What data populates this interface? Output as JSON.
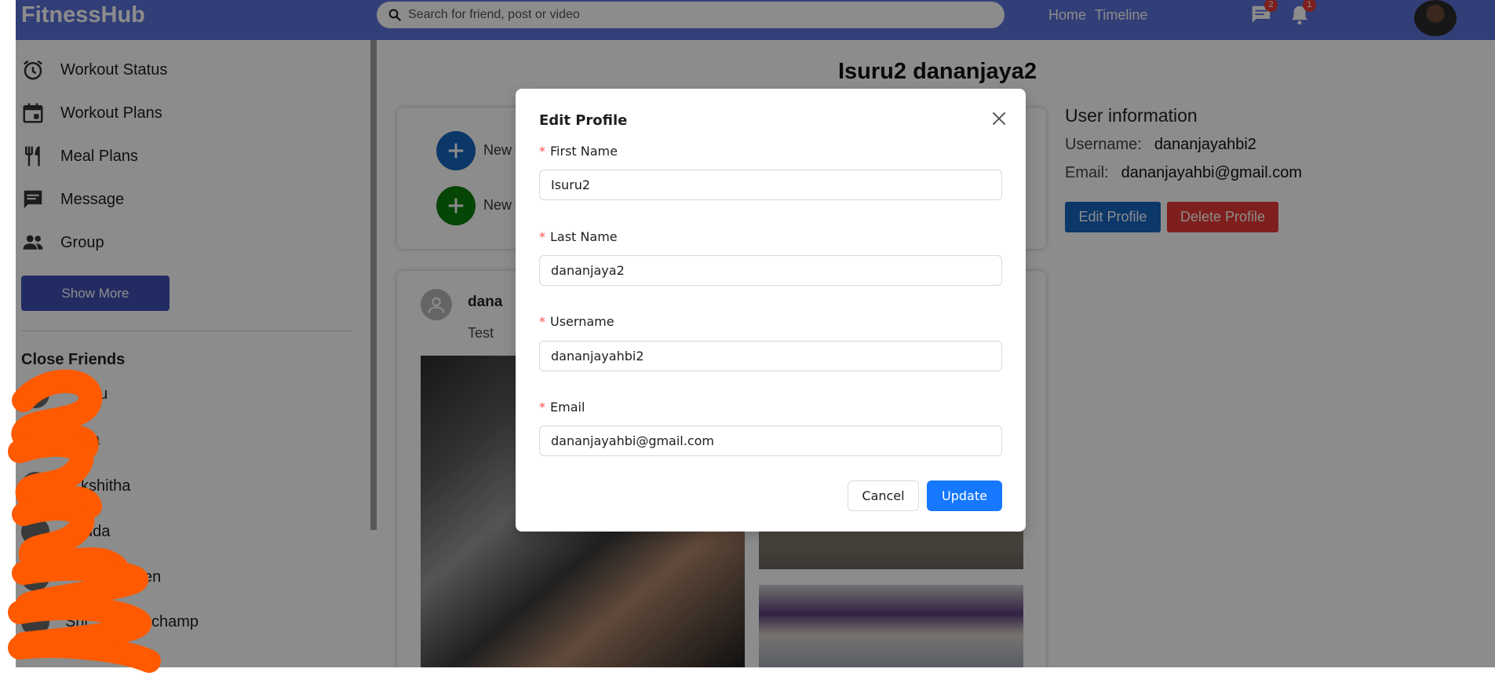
{
  "app": {
    "title": "FitnessHub"
  },
  "header": {
    "search_placeholder": "Search for friend, post or video",
    "nav": [
      "Home",
      "Timeline"
    ],
    "messages_badge": "2",
    "notifications_badge": "1",
    "icons": {
      "search": "search-icon",
      "messages": "chat-icon",
      "notifications": "bell-icon"
    }
  },
  "sidebar": {
    "items": [
      {
        "label": "Workout Status",
        "icon": "alarm-icon"
      },
      {
        "label": "Workout Plans",
        "icon": "calendar-icon"
      },
      {
        "label": "Meal Plans",
        "icon": "utensils-icon"
      },
      {
        "label": "Message",
        "icon": "message-icon"
      },
      {
        "label": "Group",
        "icon": "group-icon"
      }
    ],
    "show_more_label": "Show More",
    "close_friends_title": "Close Friends",
    "friends": [
      "du",
      "nka",
      "kshitha",
      "uda",
      "en",
      "Shi",
      "uchamp"
    ]
  },
  "profile": {
    "name": "Isuru2 dananjaya2",
    "create_items": [
      "New",
      "New"
    ],
    "post": {
      "author": "dana",
      "text": "Test"
    },
    "info": {
      "title": "User information",
      "username_label": "Username:",
      "username_value": "dananjayahbi2",
      "email_label": "Email:",
      "email_value": "dananjayahbi@gmail.com",
      "edit_label": "Edit Profile",
      "delete_label": "Delete Profile"
    }
  },
  "modal": {
    "title": "Edit Profile",
    "required_marker": "*",
    "fields": [
      {
        "label": "First Name",
        "value": "Isuru2"
      },
      {
        "label": "Last Name",
        "value": "dananjaya2"
      },
      {
        "label": "Username",
        "value": "dananjayahbi2"
      },
      {
        "label": "Email",
        "value": "dananjayahbi@gmail.com"
      }
    ],
    "cancel_label": "Cancel",
    "update_label": "Update"
  },
  "colors": {
    "header": "#5b72d9",
    "show_more": "#3f51b5",
    "edit_button": "#1565c0",
    "delete_button": "#e53935",
    "primary": "#1677ff",
    "required": "#ff4d4f",
    "redaction": "#ff5a00"
  }
}
